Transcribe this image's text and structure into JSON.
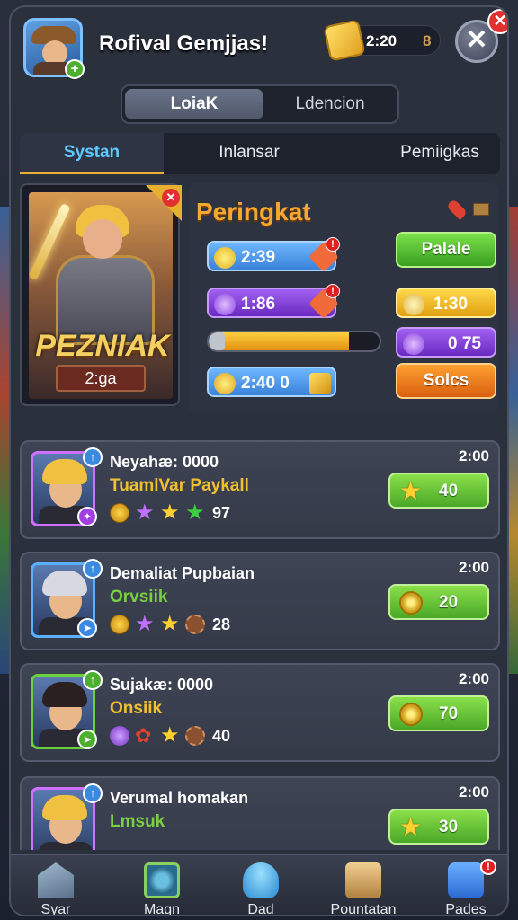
{
  "header": {
    "title": "Rofival Gemjjas!",
    "currency_time": "2:20",
    "currency_count": "8",
    "close_symbol": "✕",
    "close_badge": "✕",
    "avatar_plus": "+"
  },
  "segment": {
    "active": "LoiaK",
    "inactive": "Ldencion"
  },
  "tabs": [
    "Systan",
    "Inlansar",
    "Pemiigkas"
  ],
  "hero": {
    "name": "PEZNIAK",
    "sub": "2:ga",
    "corner": "✕"
  },
  "stats": {
    "title": "Peringkat",
    "pill1": "2:39",
    "pill2": "1:86",
    "pill3": "1:30",
    "pill4": "0  75",
    "pill5": "2:40  0",
    "btn_green": "Palale",
    "btn_orange": "Solcs",
    "alert": "!",
    "progress": 0.82
  },
  "rows": [
    {
      "name": "Neyahæ: 0000",
      "sub": "TuamlVar Paykall",
      "sub_color": "#f0c030",
      "count": "97",
      "time": "2:00",
      "reward": "40",
      "reward_icon": "star",
      "frame": "#d070ff",
      "hair": "#f0c040"
    },
    {
      "name": "Demaliat Pupbaian",
      "sub": "Orvsiik",
      "sub_color": "#7ad040",
      "count": "28",
      "time": "2:00",
      "reward": "20",
      "reward_icon": "swirl",
      "frame": "#5ab0ff",
      "hair": "#d8d8e0"
    },
    {
      "name": "Sujakæ: 0000",
      "sub": "Onsiik",
      "sub_color": "#f0c030",
      "count": "40",
      "time": "2:00",
      "reward": "70",
      "reward_icon": "swirl",
      "frame": "#6ad040",
      "hair": "#2a2020"
    },
    {
      "name": "Verumal homakan",
      "sub": "Lmsuk",
      "sub_color": "#7ad040",
      "count": "",
      "time": "2:00",
      "reward": "30",
      "reward_icon": "star",
      "frame": "#d070ff",
      "hair": "#f0c040"
    }
  ],
  "icons": {
    "up_arrow": "↑",
    "star": "★"
  },
  "nav": [
    {
      "label": "Syar"
    },
    {
      "label": "Magn"
    },
    {
      "label": "Dad"
    },
    {
      "label": "Pountatan"
    },
    {
      "label": "Pades",
      "badge": "!"
    }
  ]
}
